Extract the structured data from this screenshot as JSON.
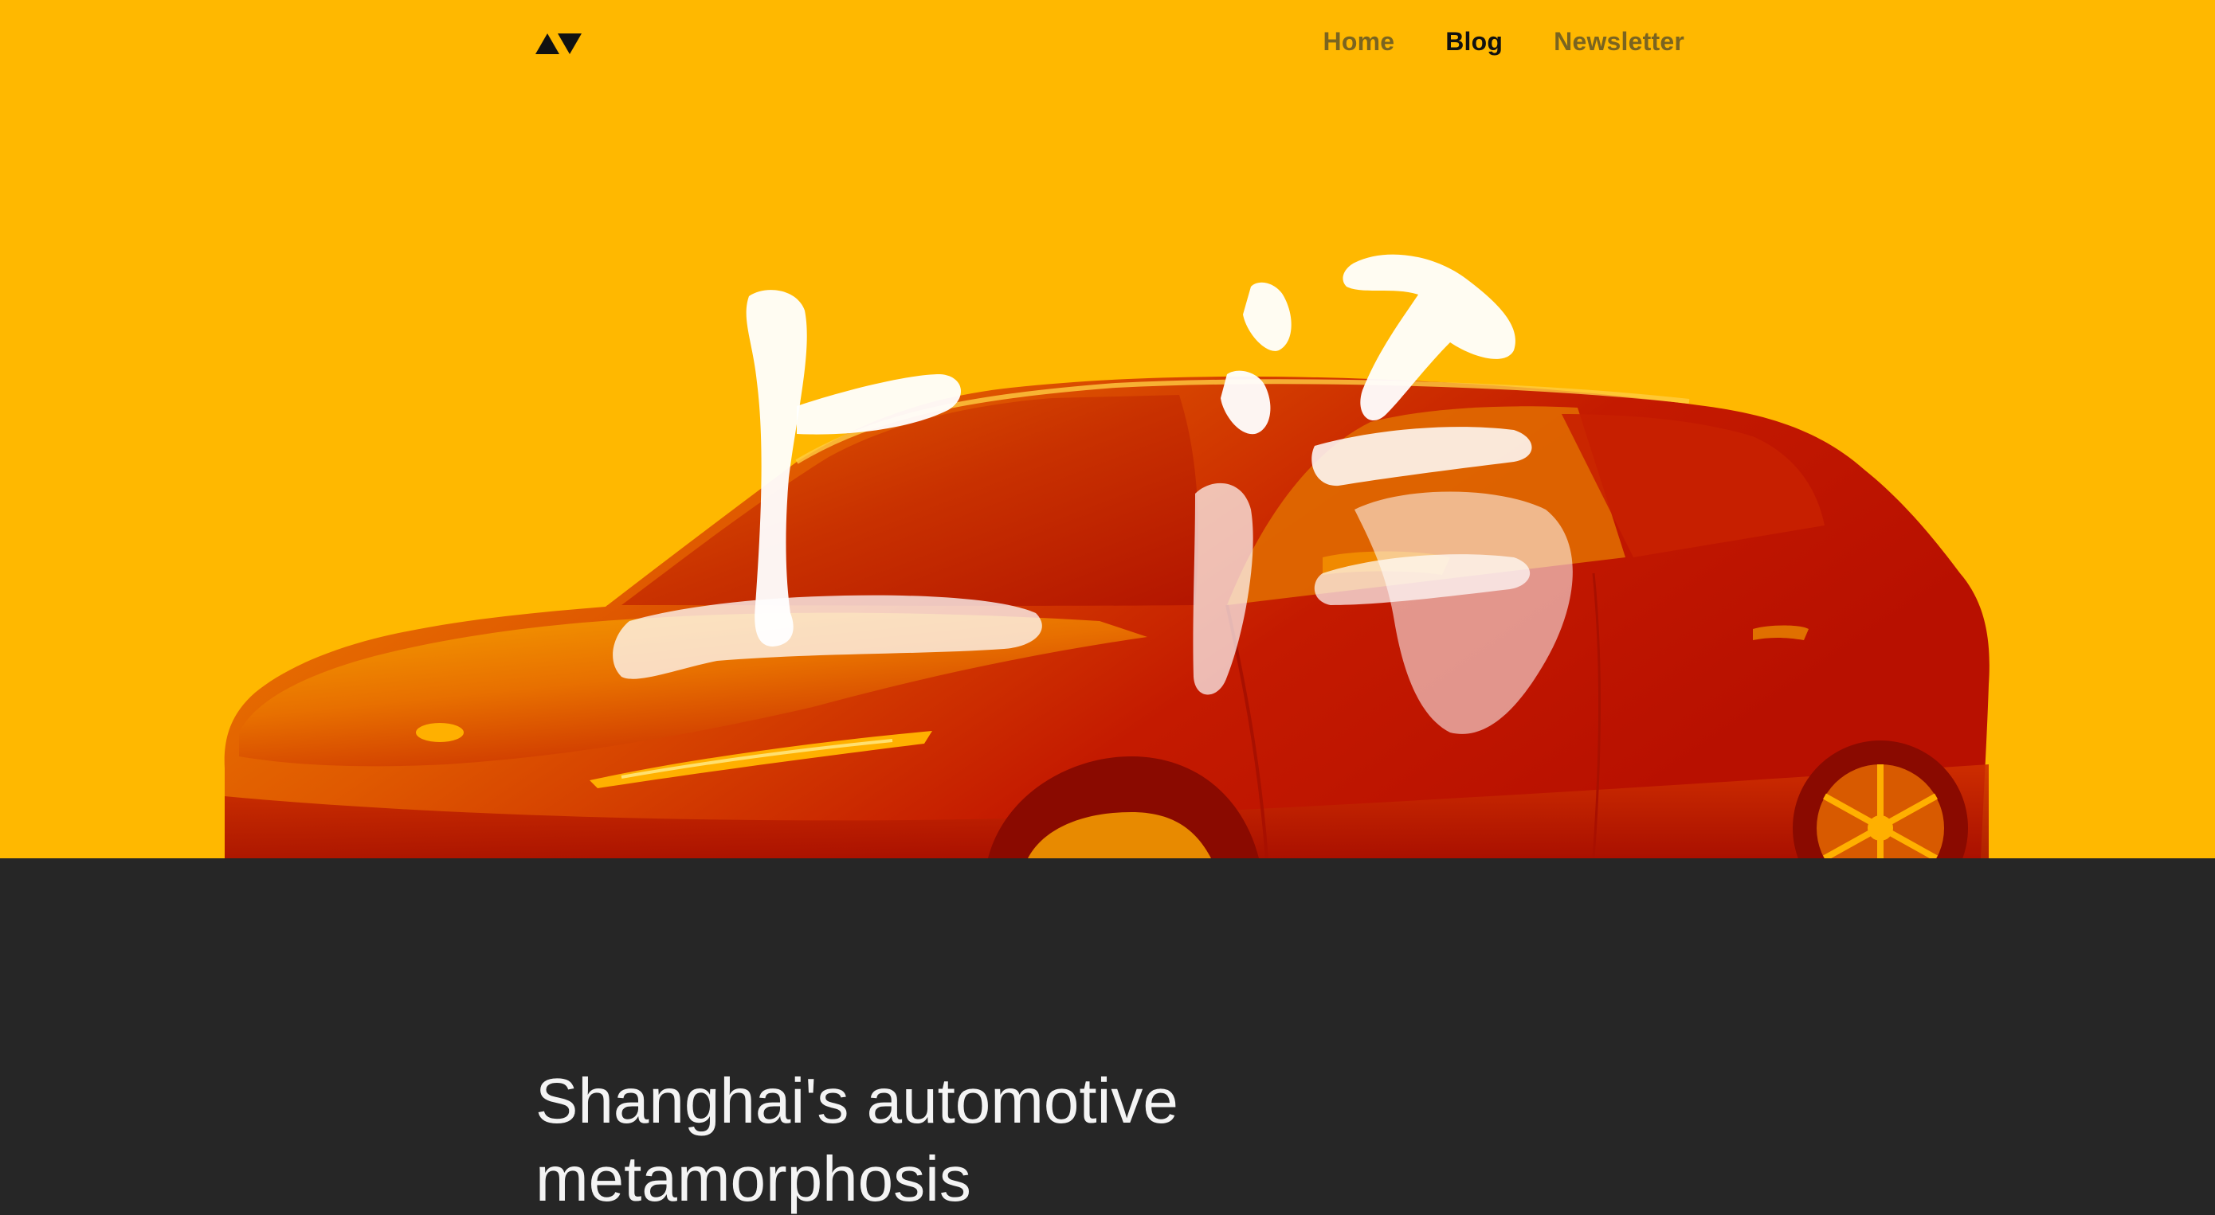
{
  "nav": {
    "logo_name": "av-logo",
    "links": [
      {
        "label": "Home",
        "active": false
      },
      {
        "label": "Blog",
        "active": true
      },
      {
        "label": "Newsletter",
        "active": false
      }
    ]
  },
  "hero": {
    "background_color": "#FFB800",
    "image_subject": "car-with-calligraphy",
    "calligraphy_text": "上海"
  },
  "article": {
    "title": "Shanghai's automotive metamorphosis"
  },
  "colors": {
    "accent_yellow": "#FFB800",
    "dark_bg": "#262626",
    "nav_inactive": "#7A6420",
    "nav_active": "#111111",
    "car_red": "#C41A00",
    "car_orange": "#F07800"
  }
}
